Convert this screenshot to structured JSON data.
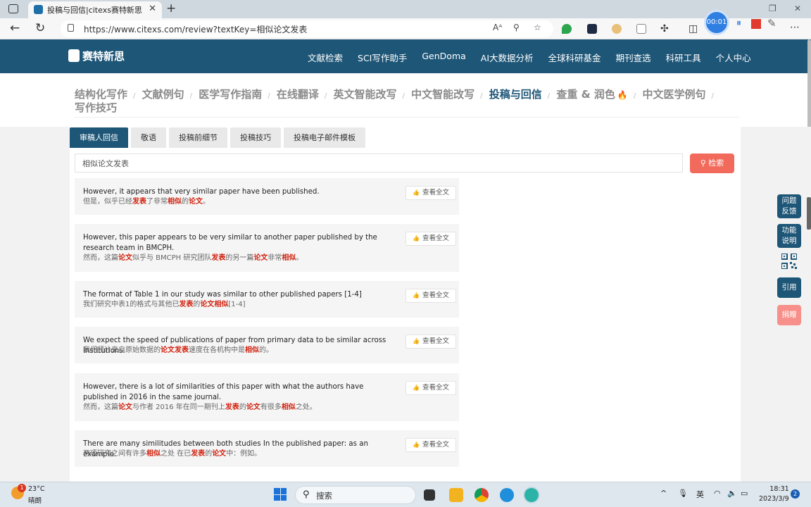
{
  "browser": {
    "tab_title": "投稿与回信|citexs赛特新思",
    "tab_close": "✕",
    "new_tab": "+",
    "url": "https://www.citexs.com/review?textKey=相似论文发表",
    "read_aloud": "A͞ᴬ",
    "zoom": "⚲",
    "recorder_time": "00:01"
  },
  "site": {
    "logo_text": "赛特新思",
    "nav": [
      "文献检索",
      "SCI写作助手",
      "GenDoma",
      "AI大数据分析",
      "全球科研基金",
      "期刊查选",
      "科研工具",
      "个人中心"
    ]
  },
  "categories": {
    "items": [
      "结构化写作",
      "文献例句",
      "医学写作指南",
      "在线翻译",
      "英文智能改写",
      "中文智能改写",
      "投稿与回信",
      "查重 & 润色",
      "中文医学例句",
      "写作技巧"
    ],
    "active": "投稿与回信",
    "sep": "/",
    "fire_icon": "🔥"
  },
  "subtabs": [
    "审稿人回信",
    "敬语",
    "投稿前细节",
    "投稿技巧",
    "投稿电子邮件模板"
  ],
  "search": {
    "value": "相似论文发表",
    "button_label": "检索",
    "button_icon": "⚲"
  },
  "results": {
    "view_full_label": "查看全文",
    "view_icon": "👍",
    "items": [
      {
        "en": "However, it appears that very similar paper have been published.",
        "zh_parts": [
          [
            "但是，似乎已经",
            false
          ],
          [
            "发表",
            true
          ],
          [
            "了非常",
            false
          ],
          [
            "相似",
            true
          ],
          [
            "的",
            false
          ],
          [
            "论文",
            true
          ],
          [
            "。",
            false
          ]
        ]
      },
      {
        "en": "However, this paper appears to be very similar to another paper published by the research team in BMCPH.",
        "zh_parts": [
          [
            "然而，这篇",
            false
          ],
          [
            "论文",
            true
          ],
          [
            "似乎与 BMCPH 研究团队",
            false
          ],
          [
            "发表",
            true
          ],
          [
            "的另一篇",
            false
          ],
          [
            "论文",
            true
          ],
          [
            "非常",
            false
          ],
          [
            "相似",
            true
          ],
          [
            "。",
            false
          ]
        ]
      },
      {
        "en": "The format of Table 1 in our study was similar to other published papers [1-4]",
        "zh_parts": [
          [
            "我们研究中表1的格式与其他已",
            false
          ],
          [
            "发表",
            true
          ],
          [
            "的",
            false
          ],
          [
            "论文",
            true
          ],
          [
            "相似",
            true
          ],
          [
            "[1-4]",
            false
          ]
        ]
      },
      {
        "en": "We expect the speed of publications of paper from primary data to be similar across institutions.",
        "zh_parts": [
          [
            "我们预计来自原始数据的",
            false
          ],
          [
            "论文",
            true
          ],
          [
            "发表",
            true
          ],
          [
            "速度在各机构中是",
            false
          ],
          [
            "相似",
            true
          ],
          [
            "的。",
            false
          ]
        ]
      },
      {
        "en": "However, there is a lot of similarities of this paper with what the authors have published in 2016 in the same journal.",
        "zh_parts": [
          [
            "然而，这篇",
            false
          ],
          [
            "论文",
            true
          ],
          [
            "与作者 2016 年在同一期刊上",
            false
          ],
          [
            "发表",
            true
          ],
          [
            "的",
            false
          ],
          [
            "论文",
            true
          ],
          [
            "有很多",
            false
          ],
          [
            "相似",
            true
          ],
          [
            "之处。",
            false
          ]
        ]
      },
      {
        "en": "There are many similitudes between both studies In the published paper: as an example.",
        "zh_parts": [
          [
            "两项研究之间有许多",
            false
          ],
          [
            "相似",
            true
          ],
          [
            "之处 在已",
            false
          ],
          [
            "发表",
            true
          ],
          [
            "的",
            false
          ],
          [
            "论文",
            true
          ],
          [
            "中：例如。",
            false
          ]
        ]
      }
    ]
  },
  "sidebar": {
    "feedback": "问题反馈",
    "features": "功能说明",
    "qr_icon": "qr-code-icon",
    "cite": "引用",
    "donate": "捐赠"
  },
  "taskbar": {
    "weather_temp": "23°C",
    "weather_desc": "晴朗",
    "weather_badge": "1",
    "search_label": "搜索",
    "ime": "英",
    "time": "18:31",
    "date": "2023/3/9",
    "notif_count": "2"
  },
  "colors": {
    "header": "#1e5677",
    "highlight": "#d1210e",
    "search_button": "#f26a5c",
    "side_blue": "#1e5677",
    "side_pink": "#f7908a"
  }
}
